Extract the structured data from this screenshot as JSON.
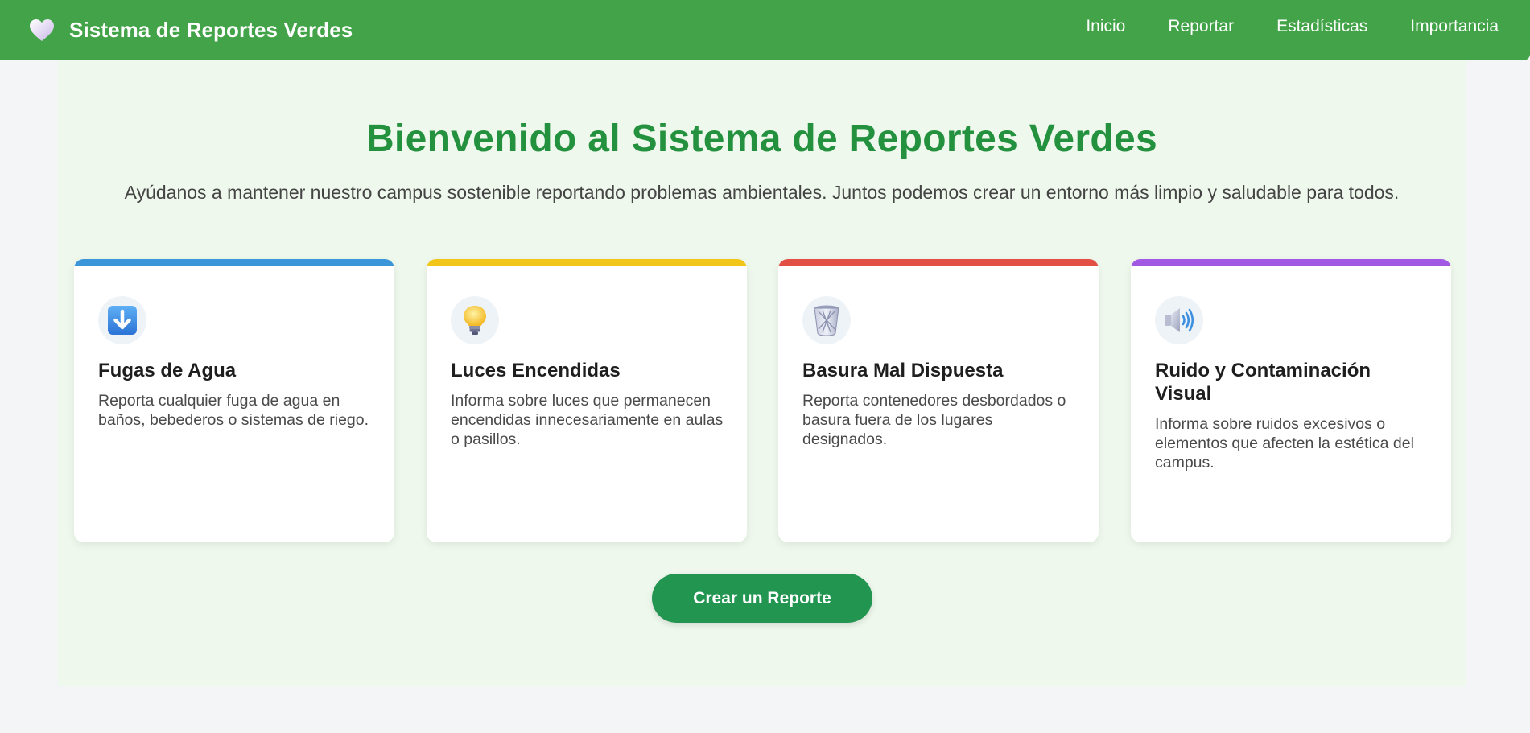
{
  "header": {
    "title": "Sistema de Reportes Verdes",
    "logo_icon": "heart-icon",
    "nav": [
      {
        "label": "Inicio"
      },
      {
        "label": "Reportar"
      },
      {
        "label": "Estadísticas"
      },
      {
        "label": "Importancia"
      }
    ]
  },
  "hero": {
    "title": "Bienvenido al Sistema de Reportes Verdes",
    "subtitle": "Ayúdanos a mantener nuestro campus sostenible reportando problemas ambientales. Juntos podemos crear un entorno más limpio y saludable para todos."
  },
  "cards": [
    {
      "title": "Fugas de Agua",
      "description": "Reporta cualquier fuga de agua en baños, bebederos o sistemas de riego.",
      "icon": "down-arrow-icon",
      "accent": "#3a96d8"
    },
    {
      "title": "Luces Encendidas",
      "description": "Informa sobre luces que permanecen encendidas innecesariamente en aulas o pasillos.",
      "icon": "lightbulb-icon",
      "accent": "#f2c618"
    },
    {
      "title": "Basura Mal Dispuesta",
      "description": "Reporta contenedores desbordados o basura fuera de los lugares designados.",
      "icon": "trash-icon",
      "accent": "#e14f45"
    },
    {
      "title": "Ruido y Contaminación Visual",
      "description": "Informa sobre ruidos excesivos o elementos que afecten la estética del campus.",
      "icon": "speaker-icon",
      "accent": "#a159e3"
    }
  ],
  "cta": {
    "label": "Crear un Reporte"
  },
  "colors": {
    "header": "#43a348",
    "title": "#24913f",
    "button": "#229551",
    "hero_bg": "#eef8ec"
  }
}
